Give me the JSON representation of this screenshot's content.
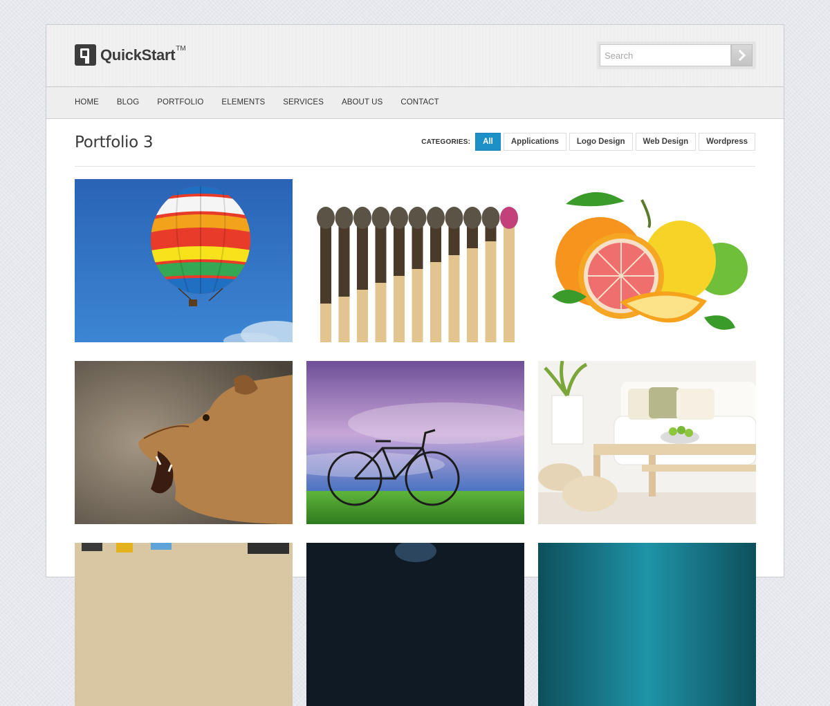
{
  "site": {
    "logo_text": "QuickStart",
    "logo_tm": "TM"
  },
  "search": {
    "placeholder": "Search",
    "button_icon": "chevron-right-icon"
  },
  "nav": {
    "items": [
      {
        "label": "HOME"
      },
      {
        "label": "BLOG"
      },
      {
        "label": "PORTFOLIO"
      },
      {
        "label": "ELEMENTS"
      },
      {
        "label": "SERVICES"
      },
      {
        "label": "ABOUT US"
      },
      {
        "label": "CONTACT"
      }
    ]
  },
  "page": {
    "title": "Portfolio 3"
  },
  "categories": {
    "label": "CATEGORIES:",
    "items": [
      {
        "label": "All",
        "active": true
      },
      {
        "label": "Applications",
        "active": false
      },
      {
        "label": "Logo Design",
        "active": false
      },
      {
        "label": "Web Design",
        "active": false
      },
      {
        "label": "Wordpress",
        "active": false
      }
    ]
  },
  "portfolio": {
    "items": [
      {
        "subject": "hot-air-balloon"
      },
      {
        "subject": "burnt-matches"
      },
      {
        "subject": "citrus-fruits"
      },
      {
        "subject": "lioness"
      },
      {
        "subject": "bicycle-on-grass"
      },
      {
        "subject": "living-room-interior"
      },
      {
        "subject": "desk-tools"
      },
      {
        "subject": "dark-portrait"
      },
      {
        "subject": "teal-abstract"
      }
    ]
  },
  "colors": {
    "accent": "#1e90c8",
    "text": "#333333",
    "header_bg": "#f1f1f2"
  }
}
